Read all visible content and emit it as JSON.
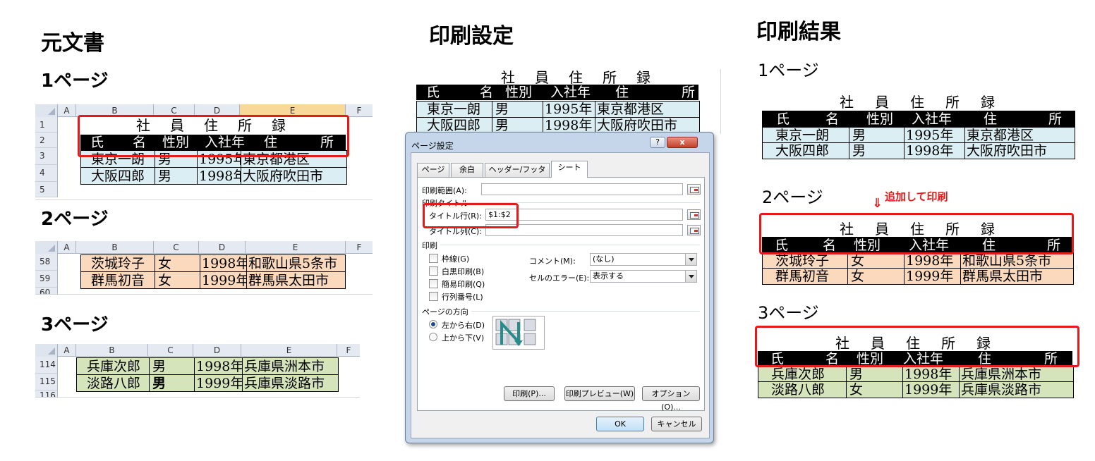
{
  "headings": {
    "original": "元文書",
    "settings": "印刷設定",
    "result": "印刷結果",
    "page1": "1ページ",
    "page2": "2ページ",
    "page3": "3ページ",
    "r_page1": "1ページ",
    "r_page2": "2ページ",
    "r_page3": "3ページ",
    "annotation": "追加して印刷"
  },
  "sheet": {
    "cols": [
      "A",
      "B",
      "C",
      "D",
      "E",
      "F"
    ],
    "title": [
      "社",
      "員",
      "住",
      "所",
      "録"
    ],
    "header": {
      "name1": "氏",
      "name2": "名",
      "gender": "性別",
      "year": "入社年",
      "addr1": "住",
      "addr2": "所"
    },
    "page1_rows": [
      {
        "num": "1",
        "name": "",
        "gender": "",
        "year": "",
        "addr": ""
      },
      {
        "num": "2",
        "name": "",
        "gender": "",
        "year": "",
        "addr": ""
      },
      {
        "num": "3",
        "name": "東京一朗",
        "gender": "男",
        "year": "1995年",
        "addr": "東京都港区"
      },
      {
        "num": "4",
        "name": "大阪四郎",
        "gender": "男",
        "year": "1998年",
        "addr": "大阪府吹田市"
      },
      {
        "num": "5"
      }
    ],
    "page2_rows": [
      {
        "num": "58",
        "name": "茨城玲子",
        "gender": "女",
        "year": "1998年",
        "addr": "和歌山県5条市"
      },
      {
        "num": "59",
        "name": "群馬初音",
        "gender": "女",
        "year": "1999年",
        "addr": "群馬県太田市"
      },
      {
        "num": "60"
      }
    ],
    "page3_rows": [
      {
        "num": "114",
        "name": "兵庫次郎",
        "gender": "男",
        "year": "1998年",
        "addr": "兵庫県洲本市"
      },
      {
        "num": "115",
        "name": "淡路八郎",
        "gender": "男",
        "year": "1999年",
        "addr": "兵庫県淡路市"
      },
      {
        "num": "116"
      }
    ],
    "result_p2_row1": {
      "name": "茨城玲子",
      "gender": "女",
      "year": "1998年",
      "addr": "和歌山県5条市"
    },
    "result_p2_row2": {
      "name": "群馬初音",
      "gender": "女",
      "year": "1999年",
      "addr": "群馬県太田市"
    },
    "result_p3_row1": {
      "name": "兵庫次郎",
      "gender": "男",
      "year": "1998年",
      "addr": "兵庫県洲本市"
    },
    "result_p3_row2": {
      "name": "淡路八郎",
      "gender": "女",
      "year": "1999年",
      "addr": "兵庫県淡路市"
    }
  },
  "dialog": {
    "title": "ページ設定",
    "help": "?",
    "close": "x",
    "tabs": [
      "ページ",
      "余白",
      "ヘッダー/フッター",
      "シート"
    ],
    "print_area_label": "印刷範囲(A):",
    "print_titles_label": "印刷タイトル",
    "title_rows_label": "タイトル行(R):",
    "title_rows_value": "$1:$2",
    "title_cols_label": "タイトル列(C):",
    "print_group": "印刷",
    "options": [
      "枠線(G)",
      "白黒印刷(B)",
      "簡易印刷(Q)",
      "行列番号(L)"
    ],
    "comment_label": "コメント(M):",
    "comment_value": "(なし)",
    "cell_error_label": "セルのエラー(E):",
    "cell_error_value": "表示する",
    "order_group": "ページの方向",
    "order_options": [
      "左から右(D)",
      "上から下(V)"
    ],
    "print_btn": "印刷(P)...",
    "preview_btn": "印刷プレビュー(W)",
    "options_btn": "オプション(O)...",
    "ok_btn": "OK",
    "cancel_btn": "キャンセル"
  }
}
